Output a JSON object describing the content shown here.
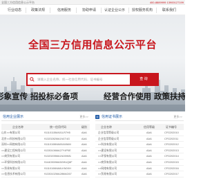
{
  "topbar": {
    "left_text": "全国三方信用信息公示平台",
    "right_text": "400-8889999  13900127199"
  },
  "nav": {
    "items": [
      "行业动态",
      "政策法规",
      "信用服务",
      "协助申请",
      "认证企业公示",
      "授权服务机构",
      "联系我们"
    ]
  },
  "hero": {
    "title": "全国三方信用信息公示平台",
    "search_placeholder": "请输入企业名称、统一社会信用代码、证书编号",
    "search_button": "查 询",
    "slogan_left": "形象宣传  招投标必备项",
    "slogan_right": "经营合作使用  政策扶持"
  },
  "left_panel": {
    "title": "信用企业展示",
    "more": "更多>>",
    "columns": [
      "企业名称",
      "统一信用代码",
      "级别"
    ],
    "rows": [
      [
        "山东××有限公司",
        "91110115MA01LR7H5",
        "AAA"
      ],
      [
        "北京××科技有限公司",
        "91320282MA1N1T4G",
        "AAA"
      ],
      [
        "深圳××网络有限公司",
        "91110108MA00AX84M",
        "AAA"
      ],
      [
        "××建设工程有限公司",
        "91330106MA27Y4P0E",
        "AAA"
      ],
      [
        "××商贸有限公司",
        "91320205MA1MJ0W8J",
        "AAA"
      ],
      [
        "××环保科技有限公司",
        "91440300MA5GHUQ6F",
        "AAA"
      ],
      [
        "××贸易有限公司",
        "91110106MA0LKN0XH",
        "AAA"
      ],
      [
        "××信息技术有限公司",
        "91330102MA28MAG67",
        "AAA"
      ]
    ]
  },
  "right_panel": {
    "title": "信用证书展示",
    "more": "更多>>",
    "columns": [
      "企业名称",
      "信用等级",
      "证书编号"
    ],
    "rows": [
      [
        "企业信用等级公司",
        "AAA",
        "CFG202010"
      ],
      [
        "企业信用等级公司",
        "AAA",
        "CFG202011"
      ],
      [
        "××科技有限公司",
        "AAA",
        "CFG202012"
      ],
      [
        "××建设有限公司",
        "AAA",
        "CFG202013"
      ],
      [
        "××环保有限公司",
        "AAA",
        "CFG202014"
      ],
      [
        "××商贸有限公司",
        "AAA",
        "CFG202015"
      ],
      [
        "××网络有限公司",
        "AAA",
        "CFG202016"
      ],
      [
        "××贸易有限公司",
        "AAA",
        "CFG202017"
      ]
    ]
  },
  "colors": {
    "brand_red": "#c8161d",
    "link_blue": "#1f5aa6"
  }
}
